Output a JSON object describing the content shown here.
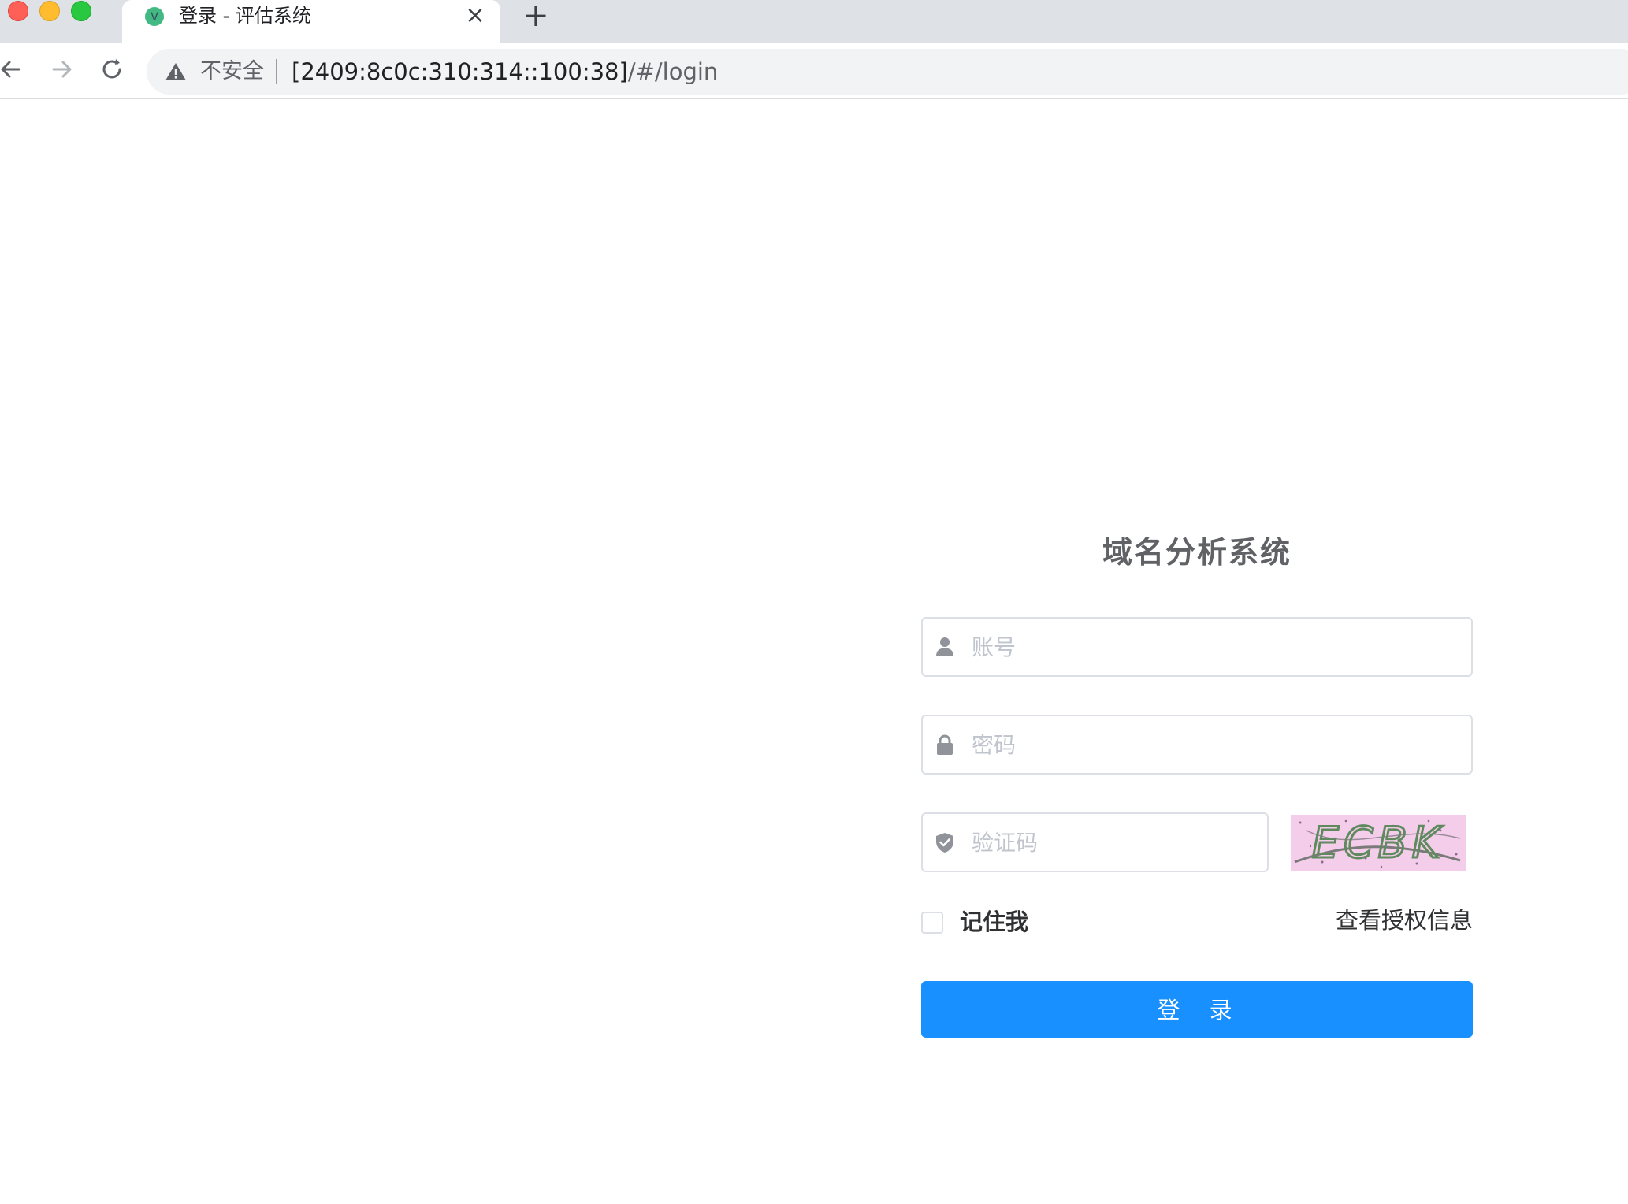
{
  "browser": {
    "tab": {
      "title": "登录 - 评估系统",
      "favicon": "vue-logo-icon",
      "close_glyph": "×"
    },
    "new_tab_glyph": "+",
    "address_bar": {
      "security_label": "不安全",
      "url_host": "[2409:8c0c:310:314::100:38]",
      "url_path": "/#/login"
    }
  },
  "login": {
    "title": "域名分析系统",
    "username_placeholder": "账号",
    "password_placeholder": "密码",
    "captcha_placeholder": "验证码",
    "captcha_text": "ECBK",
    "remember_label": "记住我",
    "remember_checked": false,
    "license_link": "查看授权信息",
    "submit_label": "登 录"
  },
  "colors": {
    "primary": "#1890ff",
    "title": "#606266",
    "placeholder": "#c0c4cc",
    "border": "#dcdfe6",
    "captcha_bg": "#f4cdea"
  }
}
